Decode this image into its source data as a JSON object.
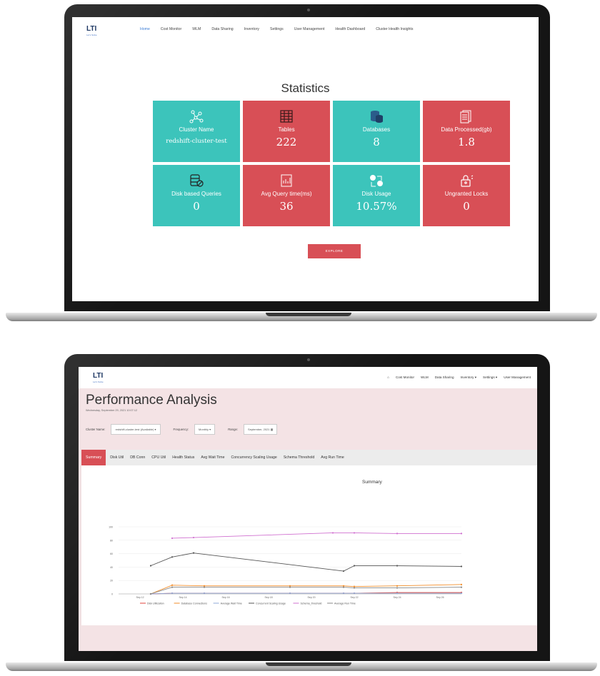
{
  "top_app": {
    "logo": "LTI",
    "logo_tagline": "Let's Solve",
    "nav": [
      "Home",
      "Cost Monitor",
      "WLM",
      "Data Sharing",
      "Inventory",
      "Settings",
      "User Management",
      "Health Dashboard",
      "Cluster Health Insights"
    ],
    "active_nav": "Home",
    "heading": "Statistics",
    "tiles": [
      {
        "icon": "network-icon",
        "label": "Cluster Name",
        "value": "redshift-cluster-test",
        "color": "#3cc4bb"
      },
      {
        "icon": "table-icon",
        "label": "Tables",
        "value": "222",
        "color": "#d84f56"
      },
      {
        "icon": "database-icon",
        "label": "Databases",
        "value": "8",
        "color": "#3cc4bb"
      },
      {
        "icon": "documents-icon",
        "label": "Data Processed(gb)",
        "value": "1.8",
        "color": "#d84f56"
      },
      {
        "icon": "disk-query-icon",
        "label": "Disk based Queries",
        "value": "0",
        "color": "#3cc4bb"
      },
      {
        "icon": "report-icon",
        "label": "Avg Query time(ms)",
        "value": "36",
        "color": "#d84f56"
      },
      {
        "icon": "disk-usage-icon",
        "label": "Disk Usage",
        "value": "10.57%",
        "color": "#3cc4bb"
      },
      {
        "icon": "lock-icon",
        "label": "Ungranted Locks",
        "value": "0",
        "color": "#d84f56"
      }
    ],
    "explore_label": "EXPLORE"
  },
  "bottom_app": {
    "logo": "LTI",
    "logo_tagline": "Let's Solve",
    "nav": [
      "Cost Monitor",
      "WLM",
      "Data Sharing",
      "Inventory ▾",
      "Settings ▾",
      "User Management"
    ],
    "title": "Performance Analysis",
    "date": "Wednesday, September 29, 2021 10:07:12",
    "filters": {
      "cluster_label": "Cluster Name:",
      "cluster_value": "redshift-cluster-test (Available)",
      "frequency_label": "Frequency:",
      "frequency_value": "Monthly",
      "range_label": "Range:",
      "range_value": "September, 2021"
    },
    "tabs": [
      "Summary",
      "Disk Util",
      "DB Conn",
      "CPU Util",
      "Health Status",
      "Avg Wait Time",
      "Concurrency Scaling Usage",
      "Schema Threshold",
      "Avg Run Time"
    ],
    "active_tab": "Summary"
  },
  "chart_data": {
    "type": "line",
    "title": "Summary",
    "x": [
      "Sep 12",
      "Sep 14",
      "Sep 16",
      "Sep 18",
      "Sep 20",
      "Sep 22",
      "Sep 24",
      "Sep 26"
    ],
    "ylim": [
      0,
      100
    ],
    "yticks": [
      0,
      20,
      40,
      60,
      80,
      100
    ],
    "legend": "bottom",
    "series": [
      {
        "name": "Disk Utilization",
        "color": "#e0453c",
        "points": [
          [
            12.5,
            0
          ],
          [
            13.5,
            1
          ],
          [
            15,
            1
          ],
          [
            19,
            1
          ],
          [
            21.5,
            1
          ],
          [
            22,
            1
          ],
          [
            24,
            2
          ],
          [
            27,
            2
          ]
        ]
      },
      {
        "name": "Database Connections",
        "color": "#f28c28",
        "points": [
          [
            12.5,
            0
          ],
          [
            13.5,
            13
          ],
          [
            15,
            12
          ],
          [
            19,
            12
          ],
          [
            21.5,
            12
          ],
          [
            22,
            11
          ],
          [
            24,
            12
          ],
          [
            27,
            14
          ]
        ]
      },
      {
        "name": "Average Wait Time",
        "color": "#8fa8d8",
        "points": [
          [
            12.5,
            0
          ],
          [
            13.5,
            1
          ],
          [
            15,
            1
          ],
          [
            19,
            1
          ],
          [
            21.5,
            1
          ],
          [
            22,
            1
          ],
          [
            24,
            1
          ],
          [
            27,
            1
          ]
        ]
      },
      {
        "name": "Concurrent Scaling Usage",
        "color": "#555555",
        "points": [
          [
            12.5,
            42
          ],
          [
            13.5,
            55
          ],
          [
            14.5,
            61
          ],
          [
            21.5,
            34
          ],
          [
            22,
            42
          ],
          [
            24,
            42
          ],
          [
            27,
            41
          ]
        ]
      },
      {
        "name": "Schema_threshold",
        "color": "#d070d0",
        "points": [
          [
            13.5,
            83
          ],
          [
            14.5,
            84
          ],
          [
            21,
            91
          ],
          [
            22,
            91
          ],
          [
            24,
            90
          ],
          [
            27,
            90
          ]
        ]
      },
      {
        "name": "Average Run Time",
        "color": "#888888",
        "points": [
          [
            12.5,
            0
          ],
          [
            13.5,
            10
          ],
          [
            15,
            10
          ],
          [
            19,
            10
          ],
          [
            21.5,
            10
          ],
          [
            22,
            9
          ],
          [
            24,
            9
          ],
          [
            27,
            10
          ]
        ]
      }
    ]
  }
}
